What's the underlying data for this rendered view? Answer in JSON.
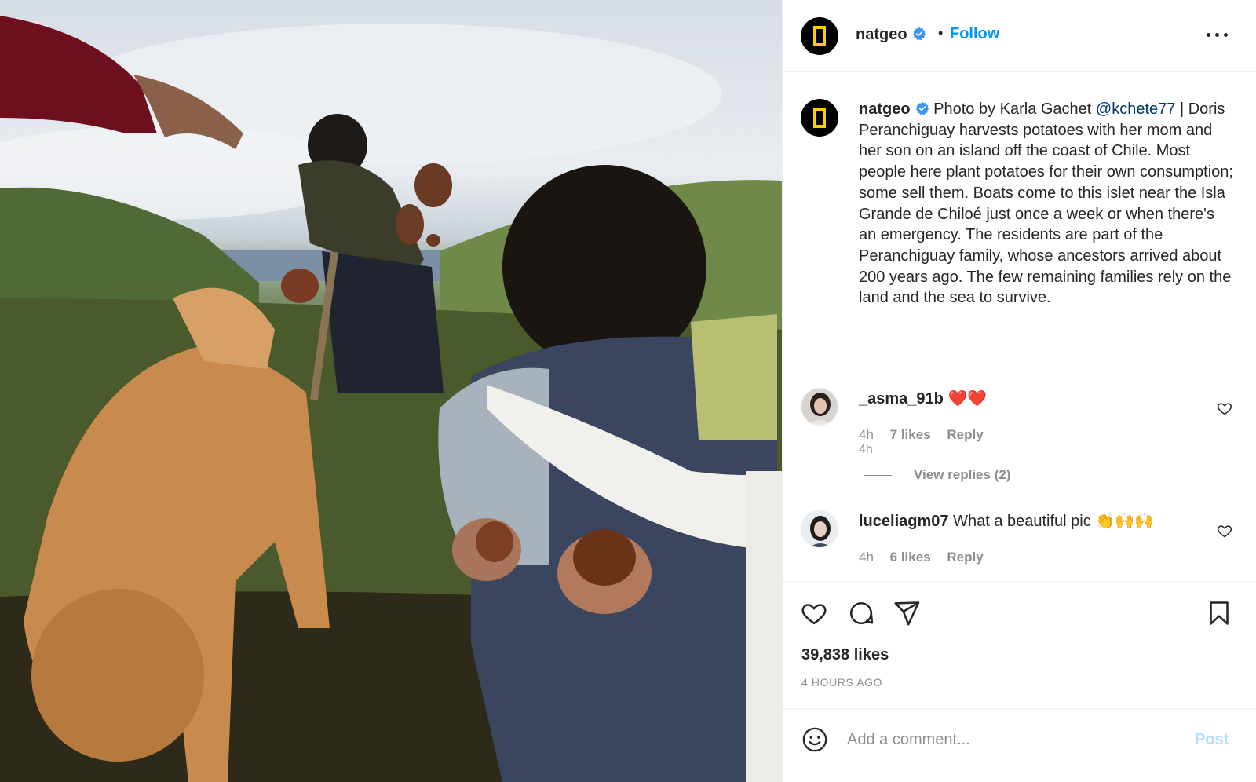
{
  "post": {
    "image_alt": "Family harvesting potatoes with a dog in a green field on an island",
    "header": {
      "username": "natgeo",
      "separator": "•",
      "follow_label": "Follow",
      "more_icon": "more-options-icon"
    },
    "caption": {
      "username": "natgeo",
      "text_prefix": "Photo by Karla Gachet ",
      "mention": "@kchete77",
      "text_body": " | Doris Peranchiguay harvests potatoes with her mom and her son on an island off the coast of Chile. Most people here plant potatoes for their own consumption; some sell them. Boats come to this islet near the Isla Grande de Chiloé just once a week or when there's an emergency. The residents are part of the Peranchiguay family, whose ancestors arrived about 200 years ago. The few remaining families rely on the land and the sea to survive.",
      "time": "4h"
    },
    "comments": [
      {
        "username": "_asma_91b",
        "text": "❤️❤️",
        "time": "4h",
        "likes": "7 likes",
        "reply_label": "Reply",
        "view_replies": "View replies (2)"
      },
      {
        "username": "luceliagm07",
        "text": "What a beautiful pic 👏🙌🙌",
        "time": "4h",
        "likes": "6 likes",
        "reply_label": "Reply"
      }
    ],
    "likes_count": "39,838 likes",
    "time_ago": "4 HOURS AGO",
    "comment_box": {
      "placeholder": "Add a comment...",
      "post_label": "Post"
    },
    "colors": {
      "link_blue": "#0095f6",
      "mention": "#00376b",
      "muted": "#8e8e8e",
      "post_disabled": "#b2dffc",
      "brand_yellow": "#ffcf00"
    }
  }
}
